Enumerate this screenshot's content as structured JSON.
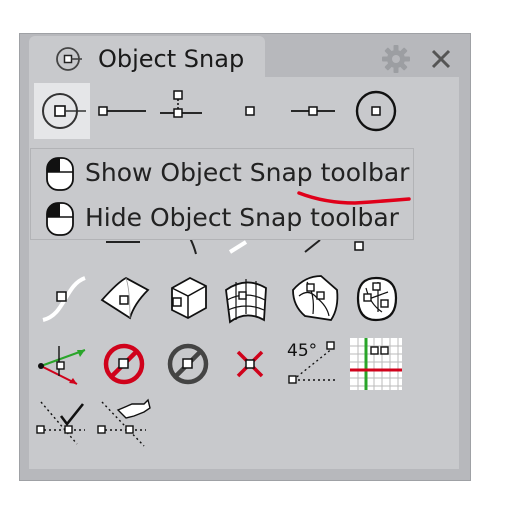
{
  "window": {
    "title": "Object Snap",
    "settings_icon": "gear-icon",
    "close_icon": "close-icon"
  },
  "colors": {
    "panel": "#c8c9cc",
    "border": "#b7b8bc",
    "accent_red": "#d0021b",
    "annotation_underline": "#e0001a",
    "green": "#2aa52a"
  },
  "toolbar_icons": [
    "snap-center-icon",
    "snap-end-icon",
    "snap-near-icon",
    "snap-point-icon",
    "snap-mid-icon",
    "snap-center-circle-icon",
    "snap-curve-icon",
    "snap-surface-icon",
    "snap-polysurface-icon",
    "snap-mesh-icon",
    "snap-subd-icon",
    "snap-brep-icon",
    "snap-tan-perp-icon",
    "snap-disable-icon",
    "snap-project-icon",
    "snap-cancel-icon",
    "snap-smarttrack-icon",
    "snap-grid-icon",
    "snap-filter-icon",
    "snap-onpoint-icon"
  ],
  "tooltip": {
    "items": [
      {
        "label": "Show Object Snap toolbar",
        "icon": "mouse-left-icon"
      },
      {
        "label": "Hide Object Snap toolbar",
        "icon": "mouse-left-icon"
      }
    ]
  },
  "smarttrack_label": "45°"
}
